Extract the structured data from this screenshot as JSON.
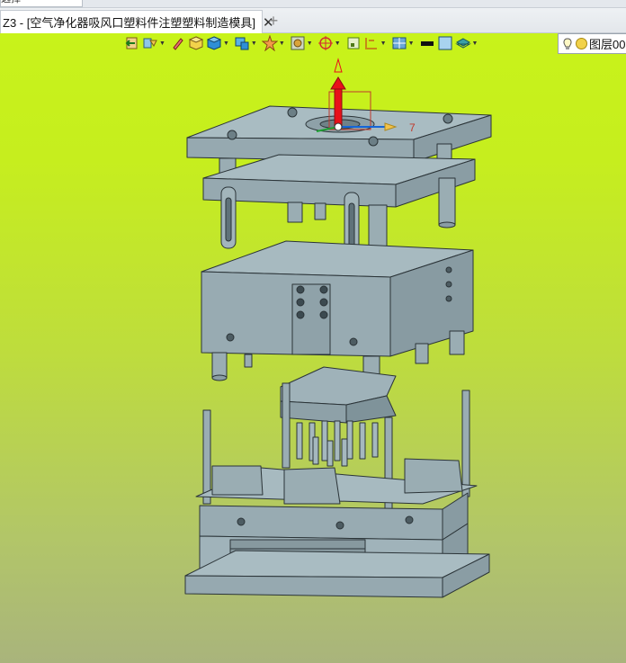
{
  "window": {
    "stub_field_text": "选择",
    "tab": {
      "label": "Z3 - [空气净化器吸风口塑料件注塑塑料制造模具]",
      "close_icon": "close-icon",
      "add_icon": "plus-icon"
    }
  },
  "toolbar": {
    "buttons": [
      {
        "name": "exit-icon",
        "dropdown": false
      },
      {
        "name": "history-icon",
        "dropdown": true
      },
      {
        "name": "pen-icon",
        "dropdown": false
      },
      {
        "name": "cube-yellow-icon",
        "dropdown": false
      },
      {
        "name": "cube-blue-icon",
        "dropdown": true
      },
      {
        "name": "view-cube-icon",
        "dropdown": true
      },
      {
        "name": "star-icon",
        "dropdown": true
      },
      {
        "name": "shading-icon",
        "dropdown": true
      },
      {
        "name": "target-icon",
        "dropdown": true
      },
      {
        "name": "frame-icon",
        "dropdown": false
      },
      {
        "name": "measure-icon",
        "dropdown": true
      },
      {
        "name": "display-grid-icon",
        "dropdown": true
      },
      {
        "name": "color-swatch-black-icon",
        "dropdown": false
      },
      {
        "name": "color-swatch-light-icon",
        "dropdown": false
      },
      {
        "name": "layers-icon",
        "dropdown": true
      }
    ],
    "layer": {
      "label": "图层00",
      "bulb_icon": "bulb-icon"
    }
  },
  "viewport": {
    "triad_label": "7",
    "colors": {
      "mold": "#9fb2b9",
      "mold_dark": "#7f939a",
      "edge": "#2b3438",
      "bg_top": "#c8f31a",
      "bg_bottom": "#a9b47c",
      "axis_z": "#e8111a",
      "axis_x": "#1565d8",
      "axis_y": "#1da032"
    }
  }
}
